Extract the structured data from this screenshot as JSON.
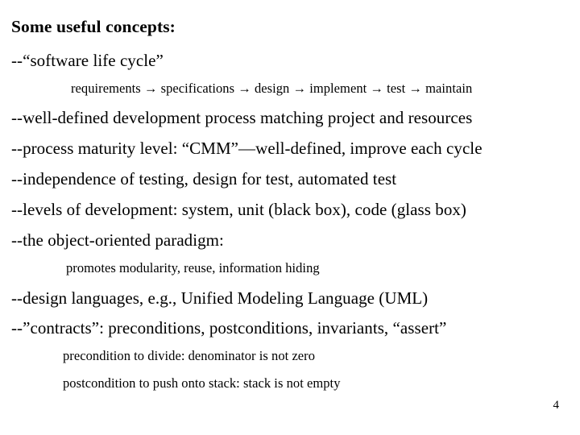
{
  "slide": {
    "background_color": "#ffffff",
    "text_color": "#000000",
    "heading": "Some useful concepts:",
    "page_number": "4",
    "bullets": [
      {
        "id": "software-life-cycle",
        "text": "--“software life cycle”"
      },
      {
        "id": "well-defined-process",
        "text": "--well-defined development process matching project and resources"
      },
      {
        "id": "process-maturity",
        "text": "--process maturity level: “CMM”—well-defined, improve each cycle"
      },
      {
        "id": "independence-testing",
        "text": "--independence of testing, design for test, automated test"
      },
      {
        "id": "levels-of-development",
        "text": "--levels of development: system, unit (black box), code (glass box)"
      },
      {
        "id": "object-oriented-paradigm",
        "text": "--the object-oriented paradigm:"
      },
      {
        "id": "design-languages",
        "text": "--design languages, e.g., Unified Modeling Language (UML)"
      },
      {
        "id": "contracts",
        "text": "--”contracts”:  preconditions, postconditions, invariants, “assert”"
      }
    ],
    "sublines": [
      {
        "id": "lifecycle-stages",
        "text": "requirements → specifications → design → implement → test → maintain"
      },
      {
        "id": "oo-benefits",
        "text": "promotes modularity, reuse, information hiding"
      },
      {
        "id": "precondition-example",
        "text": "precondition to divide: denominator is not zero"
      },
      {
        "id": "postcondition-example",
        "text": "postcondition to push onto stack: stack is not empty"
      }
    ]
  }
}
